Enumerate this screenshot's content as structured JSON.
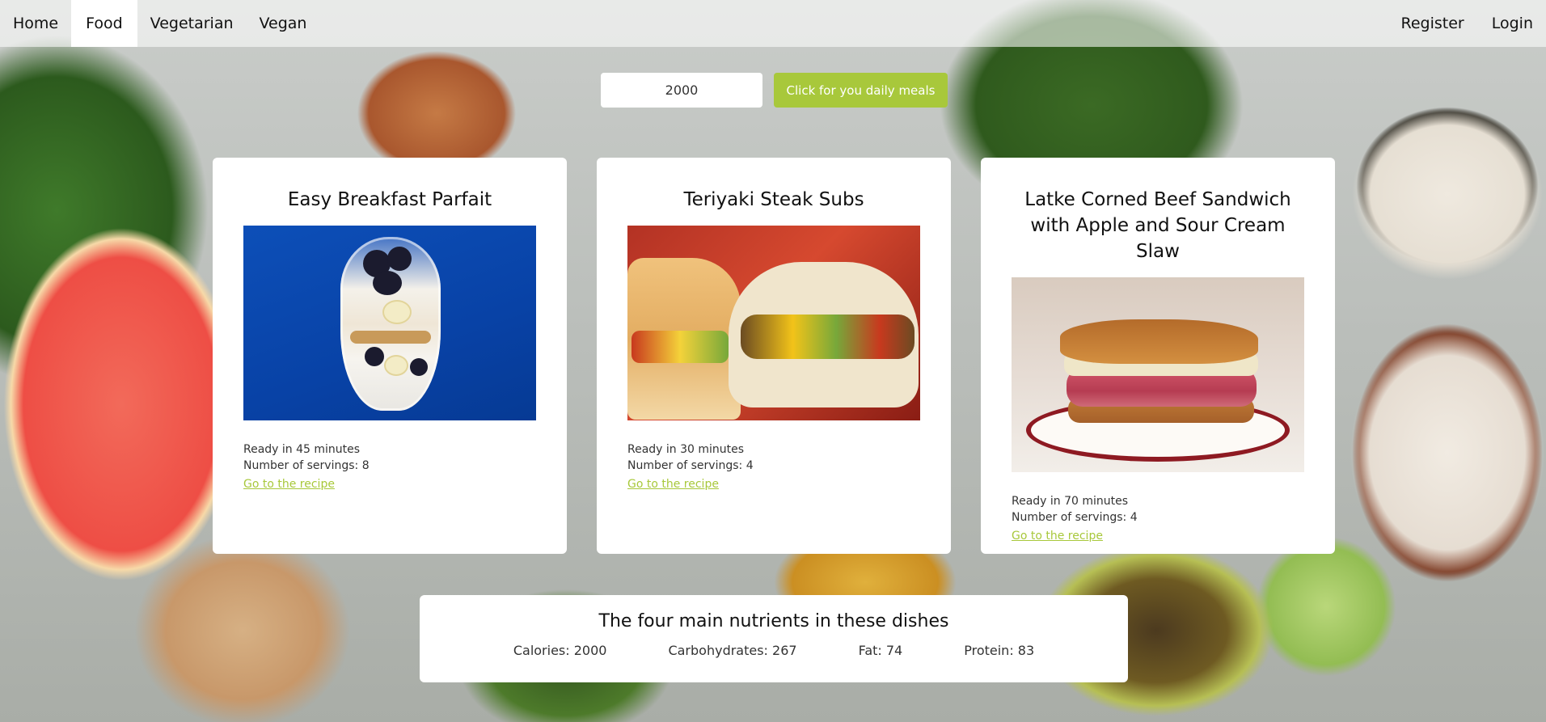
{
  "nav": {
    "items": [
      {
        "label": "Home"
      },
      {
        "label": "Food"
      },
      {
        "label": "Vegetarian"
      },
      {
        "label": "Vegan"
      }
    ],
    "active": "Food",
    "register_label": "Register",
    "login_label": "Login"
  },
  "controls": {
    "calories_value": "2000",
    "meals_button_label": "Click for you daily meals"
  },
  "recipes": [
    {
      "title": "Easy Breakfast Parfait",
      "ready": "Ready in 45 minutes",
      "servings": "Number of servings: 8",
      "link_label": "Go to the recipe"
    },
    {
      "title": "Teriyaki Steak Subs",
      "ready": "Ready in 30 minutes",
      "servings": "Number of servings: 4",
      "link_label": "Go to the recipe"
    },
    {
      "title": "Latke Corned Beef Sandwich with Apple and Sour Cream Slaw",
      "ready": "Ready in 70 minutes",
      "servings": "Number of servings: 4",
      "link_label": "Go to the recipe"
    }
  ],
  "nutrients": {
    "title": "The four main nutrients in these dishes",
    "calories": "Calories: 2000",
    "carbohydrates": "Carbohydrates: 267",
    "fat": "Fat: 74",
    "protein": "Protein: 83"
  },
  "colors": {
    "accent": "#a8c83b",
    "card_background": "#ffffff",
    "nav_background": "rgba(255,255,255,0.58)"
  }
}
